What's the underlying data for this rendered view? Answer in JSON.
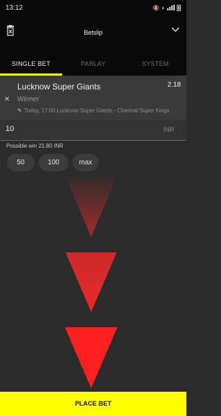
{
  "status": {
    "time": "13:12"
  },
  "header": {
    "title": "Betslip"
  },
  "tabs": [
    {
      "label": "SINGLE BET",
      "active": true
    },
    {
      "label": "PARLAY",
      "active": false
    },
    {
      "label": "SYSTEM",
      "active": false
    }
  ],
  "bet": {
    "selection": "Lucknow Super Giants",
    "odds": "2.18",
    "market": "Winner",
    "event": "Today, 17:00 Lucknow Super Giants - Chennai Super Kings"
  },
  "stake": {
    "value": "10",
    "currency": "INR",
    "possible_win": "Possible win 21.80 INR"
  },
  "quick_amounts": [
    "50",
    "100",
    "max"
  ],
  "actions": {
    "place_bet": "PLACE BET"
  },
  "colors": {
    "accent": "#ffff00",
    "arrow": "#ff2a2a",
    "background": "#2b2b2b"
  }
}
